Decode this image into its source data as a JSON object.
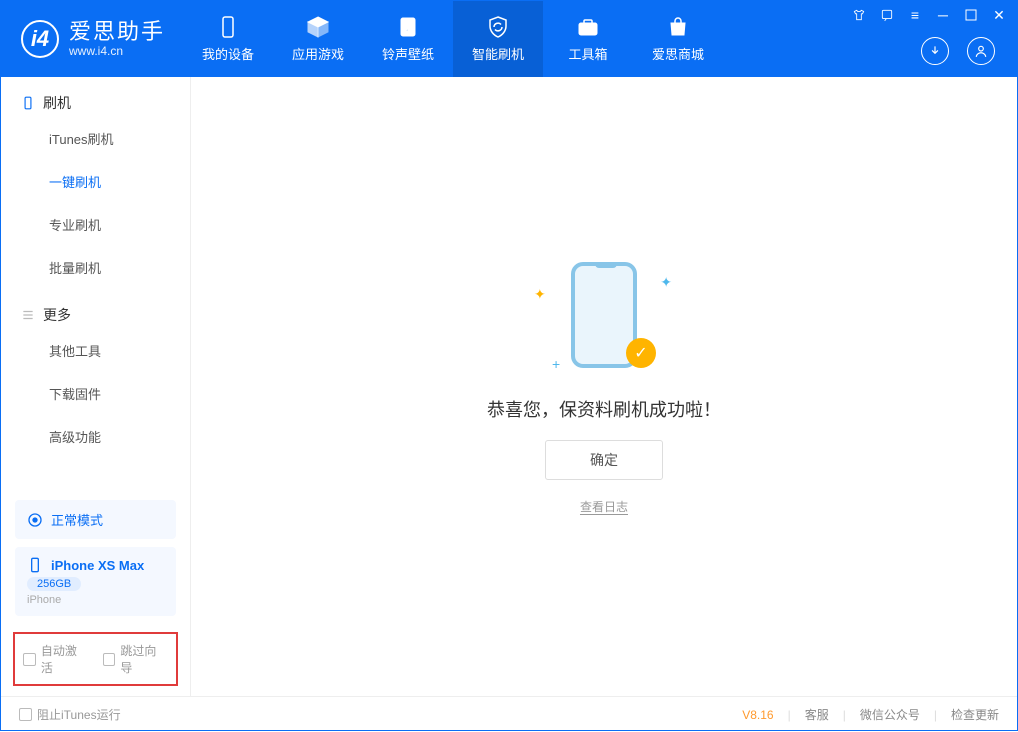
{
  "brand": {
    "name": "爱思助手",
    "sub": "www.i4.cn"
  },
  "nav": {
    "items": [
      {
        "label": "我的设备"
      },
      {
        "label": "应用游戏"
      },
      {
        "label": "铃声壁纸"
      },
      {
        "label": "智能刷机"
      },
      {
        "label": "工具箱"
      },
      {
        "label": "爱思商城"
      }
    ]
  },
  "sidebar": {
    "group1": "刷机",
    "items1": [
      {
        "label": "iTunes刷机"
      },
      {
        "label": "一键刷机"
      },
      {
        "label": "专业刷机"
      },
      {
        "label": "批量刷机"
      }
    ],
    "group2": "更多",
    "items2": [
      {
        "label": "其他工具"
      },
      {
        "label": "下载固件"
      },
      {
        "label": "高级功能"
      }
    ],
    "mode": "正常模式",
    "device": {
      "name": "iPhone XS Max",
      "capacity": "256GB",
      "type": "iPhone"
    },
    "checks": {
      "auto_activate": "自动激活",
      "skip_guide": "跳过向导"
    }
  },
  "content": {
    "success_msg": "恭喜您，保资料刷机成功啦！",
    "ok_btn": "确定",
    "log_link": "查看日志"
  },
  "footer": {
    "block_itunes": "阻止iTunes运行",
    "version": "V8.16",
    "support": "客服",
    "wechat": "微信公众号",
    "update": "检查更新"
  }
}
